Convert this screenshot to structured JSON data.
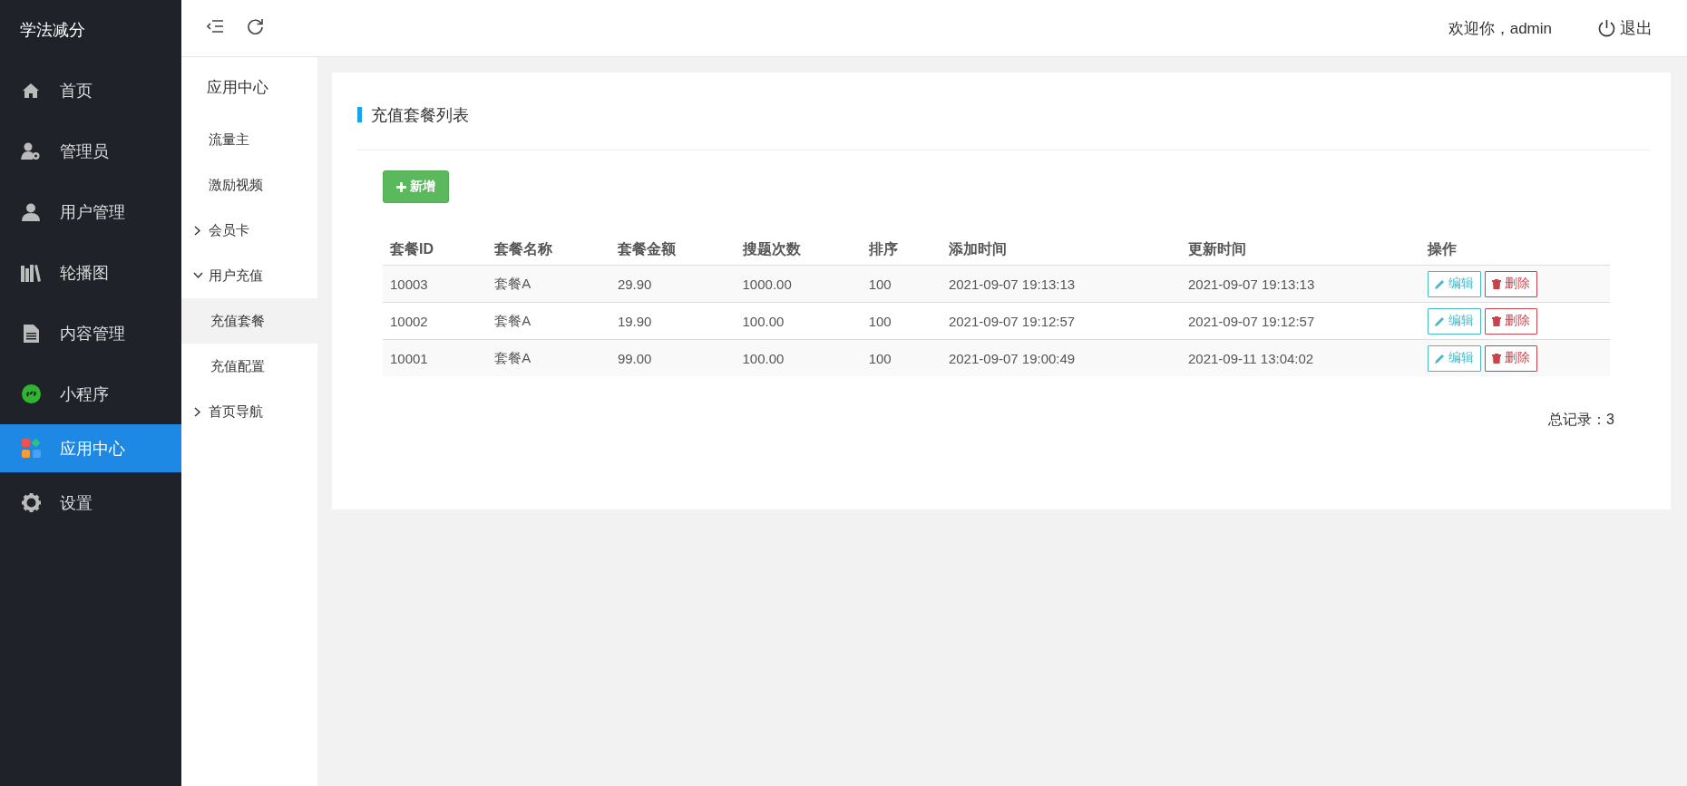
{
  "app_title": "学法减分",
  "sidebar": {
    "items": [
      {
        "label": "首页",
        "selected": false
      },
      {
        "label": "管理员",
        "selected": false
      },
      {
        "label": "用户管理",
        "selected": false
      },
      {
        "label": "轮播图",
        "selected": false
      },
      {
        "label": "内容管理",
        "selected": false
      },
      {
        "label": "小程序",
        "selected": false
      },
      {
        "label": "应用中心",
        "selected": true
      },
      {
        "label": "设置",
        "selected": false
      }
    ]
  },
  "topbar": {
    "welcome": "欢迎你，admin",
    "logout": "退出"
  },
  "submenu": {
    "title": "应用中心",
    "items": [
      {
        "label": "流量主",
        "kind": "link"
      },
      {
        "label": "激励视频",
        "kind": "link"
      },
      {
        "label": "会员卡",
        "kind": "group",
        "expanded": false
      },
      {
        "label": "用户充值",
        "kind": "group",
        "expanded": true,
        "children": [
          {
            "label": "充值套餐",
            "selected": true
          },
          {
            "label": "充值配置",
            "selected": false
          }
        ]
      },
      {
        "label": "首页导航",
        "kind": "group",
        "expanded": false
      }
    ]
  },
  "panel": {
    "title": "充值套餐列表",
    "add_button": "新增",
    "table": {
      "columns": [
        "套餐ID",
        "套餐名称",
        "套餐金额",
        "搜题次数",
        "排序",
        "添加时间",
        "更新时间",
        "操作"
      ],
      "rows": [
        {
          "cells": [
            "10003",
            "套餐A",
            "29.90",
            "1000.00",
            "100",
            "2021-09-07 19:13:13",
            "2021-09-07 19:13:13"
          ],
          "actions": [
            {
              "label": "编辑",
              "kind": "edit"
            },
            {
              "label": "删除",
              "kind": "delete"
            }
          ]
        },
        {
          "cells": [
            "10002",
            "套餐A",
            "19.90",
            "100.00",
            "100",
            "2021-09-07 19:12:57",
            "2021-09-07 19:12:57"
          ],
          "actions": [
            {
              "label": "编辑",
              "kind": "edit"
            },
            {
              "label": "删除",
              "kind": "delete"
            }
          ]
        },
        {
          "cells": [
            "10001",
            "套餐A",
            "99.00",
            "100.00",
            "100",
            "2021-09-07 19:00:49",
            "2021-09-11 13:04:02"
          ],
          "actions": [
            {
              "label": "编辑",
              "kind": "edit"
            },
            {
              "label": "删除",
              "kind": "delete"
            }
          ]
        }
      ]
    },
    "total": "总记录：3"
  }
}
